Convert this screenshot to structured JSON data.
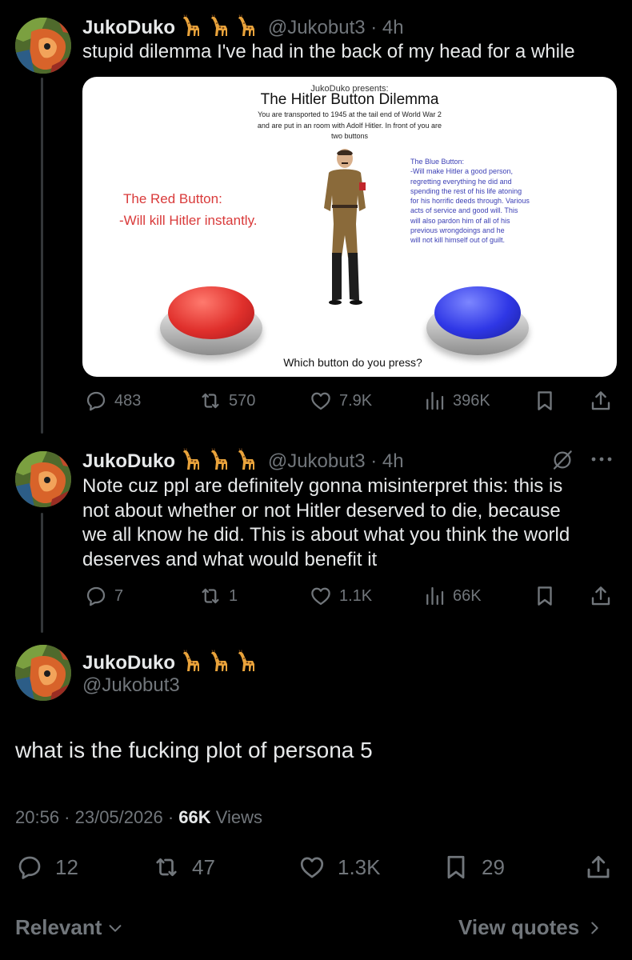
{
  "tweet1": {
    "name": "JukoDuko",
    "handle_time": "@Jukobut3 · 4h",
    "text": "stupid dilemma I've had in the back of my head for a while",
    "image": {
      "presenter": "JukoDuko presents:",
      "title": "The Hitler Button Dilemma",
      "intro_line1": "You are transported to 1945 at the tail end of World War 2",
      "intro_line2": "and are put in an room with Adolf Hitler. In front of you are",
      "intro_line3": "two buttons",
      "red_title": "The Red Button:",
      "red_desc": "-Will kill Hitler instantly.",
      "blue_lines": [
        "The Blue Button:",
        "-Will make Hitler a good person,",
        "regretting everything he did and",
        "spending the rest of his life atoning",
        "for his horrific deeds through. Various",
        "acts of service and good will. This",
        "will also pardon him of all of his",
        "previous wrongdoings and he",
        "will not kill himself out of guilt."
      ],
      "question": "Which button do you press?",
      "colors": {
        "red_button": "#e0302c",
        "blue_button": "#2f37e6",
        "red_text": "#d93a3a",
        "blue_text": "#3b3fb5"
      }
    },
    "actions": {
      "replies": "483",
      "reposts": "570",
      "likes": "7.9K",
      "views": "396K"
    }
  },
  "tweet2": {
    "name": "JukoDuko",
    "handle_time": "@Jukobut3 · 4h",
    "lines": [
      "Note cuz ppl are definitely gonna misinterpret this: this is",
      "not about whether or not Hitler deserved to die, because",
      "we all know he did. This is about what you think the world",
      "deserves and what would benefit it"
    ],
    "actions": {
      "replies": "7",
      "reposts": "1",
      "likes": "1.1K",
      "views": "66K"
    }
  },
  "main_tweet": {
    "name": "JukoDuko",
    "handle": "@Jukobut3",
    "text": "what is the fucking plot of persona 5",
    "meta_time": "20:56 · 23/05/2026 · ",
    "meta_views_count": "66K",
    "meta_views_label": " Views",
    "actions": {
      "replies": "12",
      "reposts": "47",
      "likes": "1.3K",
      "bookmarks": "29"
    }
  },
  "footer": {
    "sort_label": "Relevant",
    "view_quotes": "View quotes"
  },
  "icons": [
    "giraffe-emoji",
    "reply-icon",
    "repost-icon",
    "like-icon",
    "views-icon",
    "bookmark-icon",
    "share-icon",
    "grok-icon",
    "more-icon",
    "chevron-down-icon",
    "chevron-right-icon"
  ],
  "colors": {
    "background": "#000000",
    "text": "#e7e9ea",
    "muted": "#71767b",
    "thread_line": "#333639"
  }
}
